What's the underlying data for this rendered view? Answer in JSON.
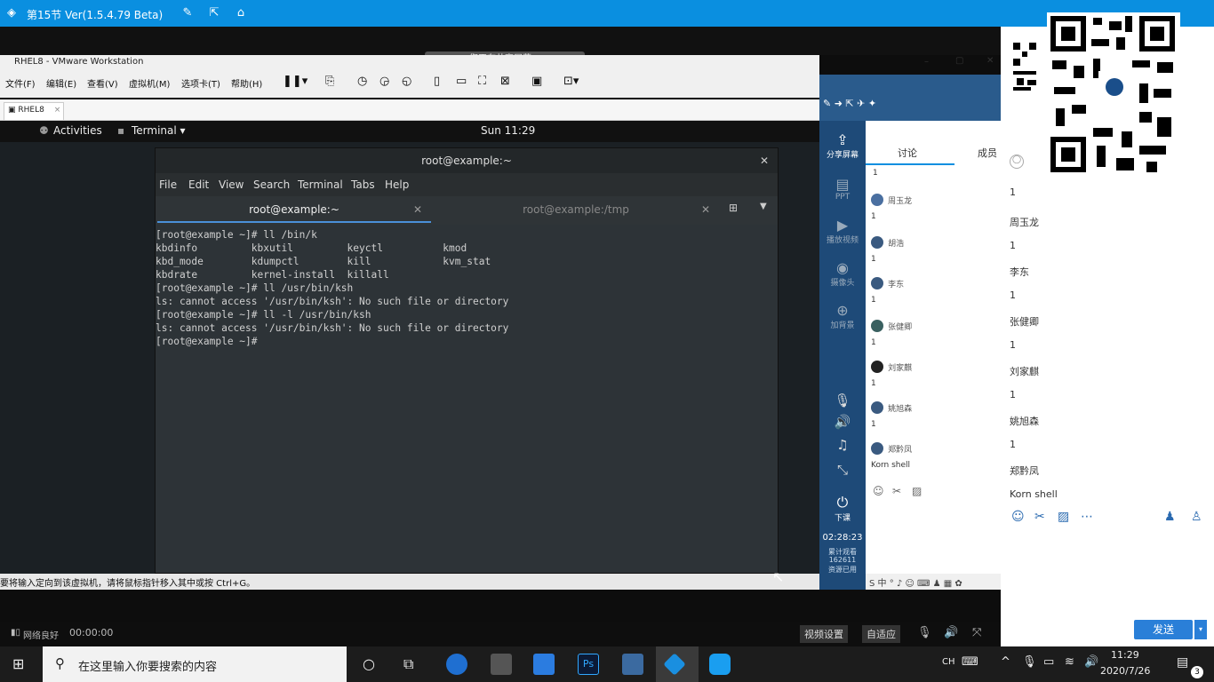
{
  "app": {
    "title": "第15节 Ver(1.5.4.79 Beta)"
  },
  "vm": {
    "window_title": "RHEL8 - VMware Workstation",
    "share_notice": "您正在共享屏幕。",
    "menu": [
      "文件(F)",
      "编辑(E)",
      "查看(V)",
      "虚拟机(M)",
      "选项卡(T)",
      "帮助(H)"
    ],
    "tab": "RHEL8",
    "status_text": "要将输入定向到该虚拟机，请将鼠标指针移入其中或按 Ctrl+G。"
  },
  "gnome": {
    "activities": "Activities",
    "app": "Terminal ▾",
    "clock": "Sun 11:29"
  },
  "terminal": {
    "title": "root@example:~",
    "menu": [
      "File",
      "Edit",
      "View",
      "Search",
      "Terminal",
      "Tabs",
      "Help"
    ],
    "tab1": "root@example:~",
    "tab2": "root@example:/tmp",
    "lines": [
      "[root@example ~]# ll /bin/k",
      "kbdinfo         kbxutil         keyctl          kmod",
      "kbd_mode        kdumpctl        kill            kvm_stat",
      "kbdrate         kernel-install  killall",
      "[root@example ~]# ll /usr/bin/ksh",
      "ls: cannot access '/usr/bin/ksh': No such file or directory",
      "[root@example ~]# ll -l /usr/bin/ksh",
      "ls: cannot access '/usr/bin/ksh': No such file or directory",
      "[root@example ~]#"
    ]
  },
  "side": {
    "share_screen": "分享屏幕",
    "ppt": "PPT",
    "play_video": "播放视频",
    "camera": "摄像头",
    "music": "加背景",
    "end_class": "下课",
    "timer": "02:28:23",
    "total_label": "累计观看",
    "total_value": "162611",
    "resource": "资源已用"
  },
  "chat_mid": {
    "tab_discuss": "讨论",
    "tab_members": "成员",
    "messages": [
      {
        "name": "",
        "text": "1"
      },
      {
        "name": "周玉龙",
        "text": "1"
      },
      {
        "name": "胡浩",
        "text": "1"
      },
      {
        "name": "李东",
        "text": "1"
      },
      {
        "name": "张健卿",
        "text": "1"
      },
      {
        "name": "刘家麒",
        "text": "1"
      },
      {
        "name": "姚旭森",
        "text": "1"
      },
      {
        "name": "郑黔凤",
        "text": "Korn shell"
      }
    ]
  },
  "chat_right": {
    "messages": [
      {
        "name": "",
        "text": "1"
      },
      {
        "name": "周玉龙",
        "text": "1"
      },
      {
        "name": "李东",
        "text": "1"
      },
      {
        "name": "张健卿",
        "text": "1"
      },
      {
        "name": "刘家麒",
        "text": "1"
      },
      {
        "name": "姚旭森",
        "text": "1"
      },
      {
        "name": "郑黔凤",
        "text": "Korn shell"
      }
    ],
    "send": "发送"
  },
  "bottom": {
    "network": "网络良好",
    "time": "00:00:00",
    "video_settings": "视频设置",
    "adaptive": "自适应"
  },
  "taskbar": {
    "search_placeholder": "在这里输入你要搜索的内容",
    "ime": "CH",
    "clock_time": "11:29",
    "clock_date": "2020/7/26",
    "notif_count": "3"
  },
  "colors": {
    "accent": "#0a8fe0",
    "side_panel": "#1e4a78",
    "terminal_bg": "#2d3337"
  }
}
